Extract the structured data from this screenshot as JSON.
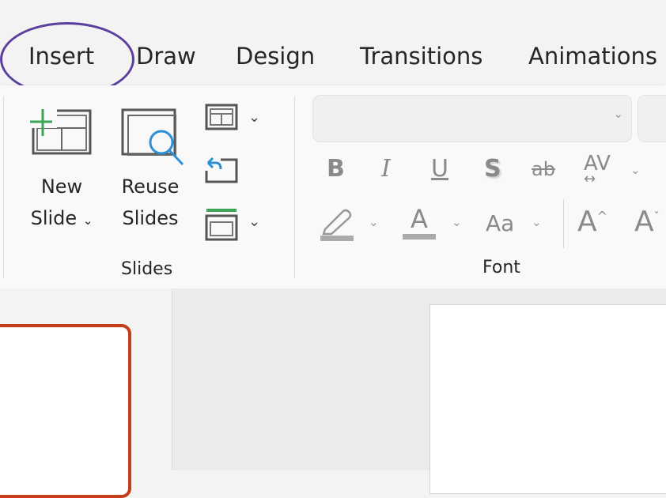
{
  "tabs": [
    {
      "label": "Insert",
      "highlighted": true
    },
    {
      "label": "Draw"
    },
    {
      "label": "Design"
    },
    {
      "label": "Transitions"
    },
    {
      "label": "Animations"
    }
  ],
  "highlight_color": "#5b3f9e",
  "slides_group": {
    "label": "Slides",
    "new_slide": [
      "New",
      "Slide"
    ],
    "reuse_slides": [
      "Reuse",
      "Slides"
    ],
    "small_buttons": [
      "layout-icon",
      "reset-icon",
      "section-icon"
    ]
  },
  "font_group": {
    "label": "Font",
    "font_name": "",
    "font_size": "",
    "buttons": {
      "bold": "B",
      "italic": "I",
      "underline": "U",
      "shadow": "S",
      "strikethrough": "ab",
      "spacing": "AV",
      "font_color": "A",
      "change_case": "Aa",
      "grow": "A",
      "shrink": "A"
    }
  },
  "colors": {
    "thumbnail_border": "#c43e1c",
    "accent_green": "#3aa655",
    "accent_blue": "#2b8fd6"
  }
}
